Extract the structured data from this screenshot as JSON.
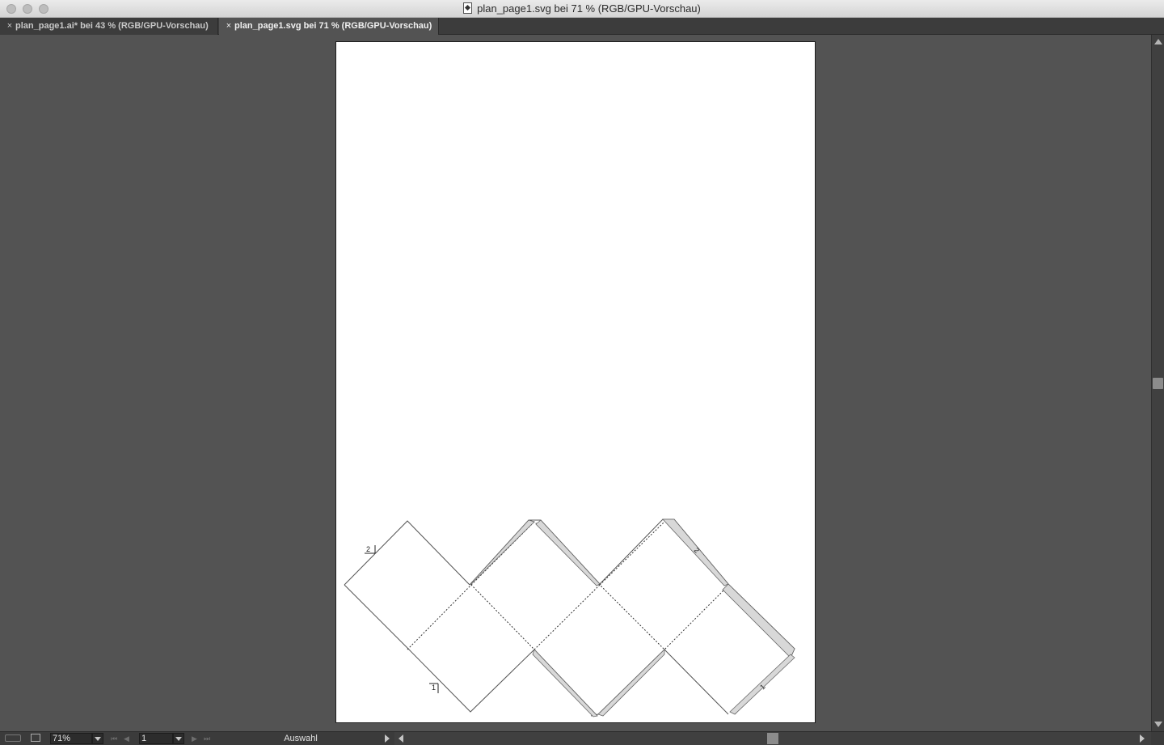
{
  "window": {
    "title": "plan_page1.svg bei 71 % (RGB/GPU-Vorschau)"
  },
  "tabs": [
    {
      "label": "plan_page1.ai* bei 43 % (RGB/GPU-Vorschau)",
      "active": false
    },
    {
      "label": "plan_page1.svg bei 71 % (RGB/GPU-Vorschau)",
      "active": true
    }
  ],
  "artwork": {
    "fold_labels": [
      "2",
      "1",
      "2",
      "1"
    ]
  },
  "statusbar": {
    "zoom_value": "71%",
    "page_value": "1",
    "tool_label": "Auswahl"
  },
  "colors": {
    "workspace": "#535353",
    "artboard": "#ffffff",
    "tab_active": "#535353",
    "tab_inactive": "#3c3c3c"
  }
}
